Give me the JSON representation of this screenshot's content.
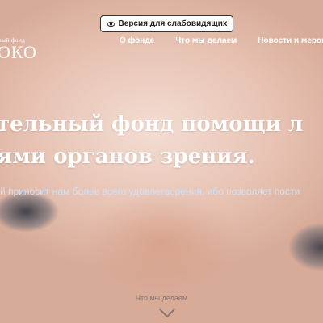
{
  "nav": {
    "low_vision_button": "Версия для слабовидящих",
    "menu": [
      "О фонде",
      "Что мы делаем",
      "Новости и меропр"
    ]
  },
  "logo": {
    "small_text": "ный фонд",
    "big_text": "ОКО"
  },
  "hero": {
    "heading_line1": "тельный фонд помощи л",
    "heading_line2": "ями органов зрения.",
    "subline": "й приносит нам более всего удовлетворения, ибо позволяет пости",
    "scroll_label": "Что мы делаем"
  },
  "icons": {
    "low_vision": "eye-icon",
    "scroll": "chevron-down-icon"
  },
  "colors": {
    "button_bg": "#ffffff",
    "button_border": "#333333",
    "nav_text": "#ffffff",
    "subline_text": "#cfe0f7"
  }
}
